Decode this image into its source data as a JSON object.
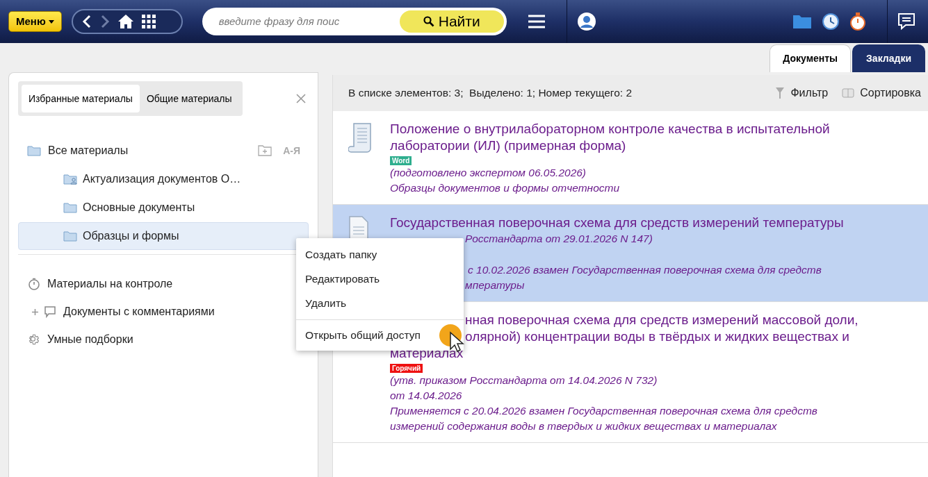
{
  "header": {
    "menu_button": "Меню",
    "search": {
      "placeholder": "введите фразу для поис"
    },
    "search_button": "Найти"
  },
  "view_tabs": [
    {
      "label": "Документы",
      "selected": true
    },
    {
      "label": "Закладки",
      "selected": false
    }
  ],
  "sidebar": {
    "tabs": [
      {
        "label": "Избранные материалы",
        "selected": true
      },
      {
        "label": "Общие материалы",
        "selected": false
      }
    ],
    "tree": {
      "label": "Все материалы",
      "sort_label": "А-Я",
      "children": [
        {
          "label": "Актуализация документов О…",
          "kind": "shared",
          "selected": false
        },
        {
          "label": "Основные документы",
          "kind": "folder",
          "selected": false
        },
        {
          "label": "Образцы и формы",
          "kind": "folder",
          "selected": true
        }
      ]
    },
    "sections": [
      {
        "label": "Материалы на контроле",
        "kind": "timer"
      },
      {
        "label": "Документы с комментариями",
        "kind": "comments"
      },
      {
        "label": "Умные подборки",
        "kind": "gear"
      }
    ]
  },
  "list": {
    "status": "В списке элементов: 3;  Выделено: 1; Номер текущего: 2",
    "filter": "Фильтр",
    "sort": "Сортировка",
    "documents": [
      {
        "title_lines": [
          {
            "text": "Положение о внутрилабораторном контроле качества в испытательной",
            "kind": "full"
          },
          {
            "text": "лаборатории (ИЛ) (примерная форма)",
            "kind": "full"
          }
        ],
        "badge": {
          "text": "Word",
          "color": "#2fae8e"
        },
        "selected": false,
        "lines": [
          {
            "text": "(подготовлено экспертом 06.05.2026)",
            "kind": "full"
          },
          {
            "text": "Образцы документов и формы отчетности",
            "kind": "full"
          }
        ]
      },
      {
        "title_lines": [
          {
            "text": "Государственная поверочная схема для средств измерений температуры",
            "kind": "full"
          }
        ],
        "selected": true,
        "lines": [
          {
            "text": "Росстандарта от 29.01.2026 N 147)",
            "kind": "partial"
          },
          {
            "text": "с 10.02.2026 взамен Государственная поверочная схема для средств",
            "kind": "partial_after_gap"
          },
          {
            "text": "мпературы",
            "kind": "partial"
          }
        ]
      },
      {
        "title_lines": [
          {
            "text": "нная поверочная схема для средств измерений массовой доли,",
            "kind": "partial"
          },
          {
            "text": "олярной) концентрации воды в твёрдых и жидких веществах и",
            "kind": "partial"
          },
          {
            "text": "материалах",
            "kind": "full"
          }
        ],
        "badge": {
          "text": "Горячий",
          "color": "#ee1111"
        },
        "selected": false,
        "lines": [
          {
            "text": "(утв. приказом Росстандарта от 14.04.2026 N 732)",
            "kind": "full"
          },
          {
            "text": "от 14.04.2026",
            "kind": "full"
          },
          {
            "text": "Применяется с 20.04.2026 взамен Государственная поверочная схема для средств",
            "kind": "full"
          },
          {
            "text": "измерений содержания воды в твердых и жидких веществах и материалах",
            "kind": "full"
          }
        ]
      }
    ]
  },
  "context_menu": {
    "items": [
      "Создать папку",
      "Редактировать",
      "Удалить"
    ],
    "footer_item": "Открыть общий доступ"
  }
}
